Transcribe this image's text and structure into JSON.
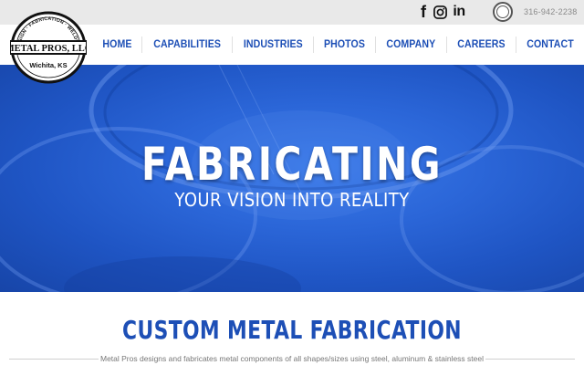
{
  "colors": {
    "brand_blue": "#1d4fb6",
    "hero_blue": "#2b66d8",
    "topbar_bg": "#e9e9e9",
    "phone_text": "#8a8a8a",
    "body_text": "#777777"
  },
  "topbar": {
    "social": [
      {
        "icon": "facebook-icon",
        "glyph": "f"
      },
      {
        "icon": "instagram-icon"
      },
      {
        "icon": "linkedin-icon",
        "glyph": "in"
      }
    ],
    "badge": {
      "icon": "aisc-badge-icon"
    },
    "phone": "316-942-2238"
  },
  "logo": {
    "arc_text": "DESIGN · FABRICATION · WELDING",
    "name": "METAL PROS, LLC",
    "location": "Wichita, KS"
  },
  "nav": {
    "items": [
      "HOME",
      "CAPABILITIES",
      "INDUSTRIES",
      "PHOTOS",
      "COMPANY",
      "CAREERS",
      "CONTACT"
    ]
  },
  "hero": {
    "title": "FABRICATING",
    "subtitle": "YOUR VISION INTO REALITY"
  },
  "section": {
    "title": "CUSTOM METAL FABRICATION",
    "body": "Metal Pros designs and fabricates metal components of all shapes/sizes using steel, aluminum & stainless steel"
  }
}
